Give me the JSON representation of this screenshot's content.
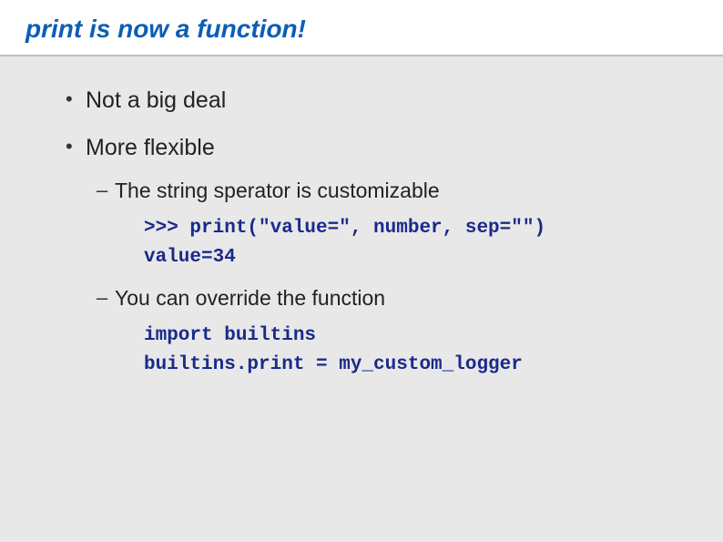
{
  "title": "print is now a function!",
  "bullets": {
    "item0": "Not a big deal",
    "item1": "More flexible",
    "sub": {
      "item0": "The string sperator is customizable",
      "code0_line0": ">>> print(\"value=\", number, sep=\"\")",
      "code0_line1": "value=34",
      "item1": "You can override the function",
      "code1_line0": "import builtins",
      "code1_line1": "builtins.print = my_custom_logger"
    }
  }
}
